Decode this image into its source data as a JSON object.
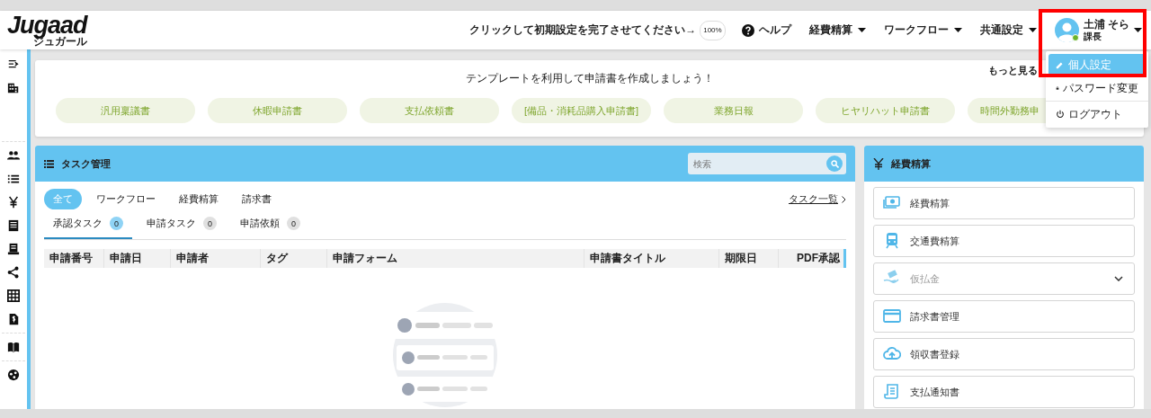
{
  "header": {
    "logo": "Jugaad",
    "logo_sub": "ジュガール",
    "setup_prompt": "クリックして初期設定を完了させてください→",
    "progress": "100%",
    "help": "ヘルプ",
    "menus": [
      {
        "label": "経費精算"
      },
      {
        "label": "ワークフロー"
      },
      {
        "label": "共通設定"
      }
    ],
    "user": {
      "name": "土浦 そら",
      "role": "課長",
      "online": true
    }
  },
  "user_menu": [
    {
      "label": "個人設定",
      "selected": true
    },
    {
      "label": "パスワード変更",
      "selected": false
    },
    {
      "label": "ログアウト",
      "selected": false
    }
  ],
  "templates": {
    "title": "テンプレートを利用して申請書を作成しましょう！",
    "more_link": "もっと見る",
    "items": [
      "汎用稟議書",
      "休暇申請書",
      "支払依頼書",
      "[備品・消耗品購入申請書]",
      "業務日報",
      "ヒヤリハット申請書",
      "時間外勤務申"
    ]
  },
  "tasks": {
    "title": "タスク管理",
    "search_placeholder": "検索",
    "list_link": "タスク一覧",
    "filters": [
      {
        "label": "全て",
        "selected": true
      },
      {
        "label": "ワークフロー",
        "selected": false
      },
      {
        "label": "経費精算",
        "selected": false
      },
      {
        "label": "請求書",
        "selected": false
      }
    ],
    "subtabs": [
      {
        "label": "承認タスク",
        "count": "0",
        "selected": true
      },
      {
        "label": "申請タスク",
        "count": "0",
        "selected": false
      },
      {
        "label": "申請依頼",
        "count": "0",
        "selected": false
      }
    ],
    "columns": [
      "申請番号",
      "申請日",
      "申請者",
      "タグ",
      "申請フォーム",
      "申請書タイトル",
      "期限日",
      "PDF承認"
    ]
  },
  "expense": {
    "title": "経費精算",
    "items": [
      {
        "label": "経費精算",
        "kind": "link",
        "disabled": false
      },
      {
        "label": "交通費精算",
        "kind": "link",
        "disabled": false
      },
      {
        "label": "仮払金",
        "kind": "group",
        "disabled": true,
        "expanded": false
      },
      {
        "label": "請求書管理",
        "kind": "link",
        "disabled": false
      },
      {
        "label": "領収書登録",
        "kind": "link",
        "disabled": false
      },
      {
        "label": "支払通知書",
        "kind": "link",
        "disabled": false
      }
    ]
  }
}
